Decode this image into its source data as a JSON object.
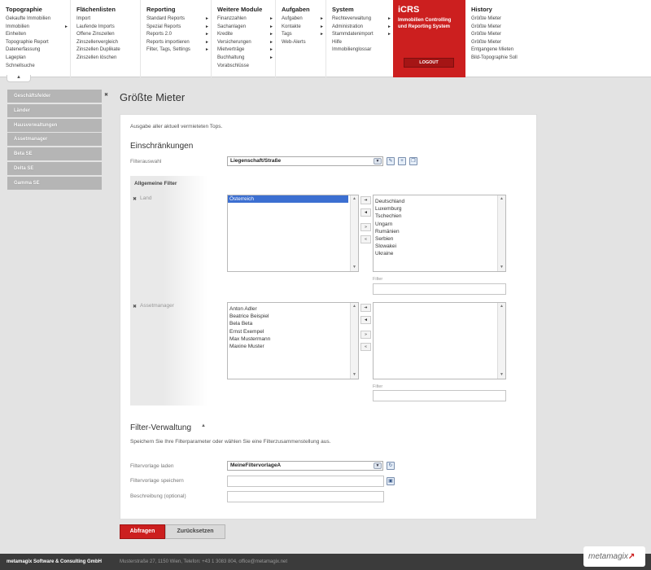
{
  "menu": {
    "topographie": {
      "head": "Topographie",
      "items": [
        "Gekaufte Immobilien",
        "Immobilien",
        "Einheiten",
        "Topographie Report",
        "Datenerfassung",
        "Lageplan",
        "Schnellsuche"
      ]
    },
    "flaechenlisten": {
      "head": "Flächenlisten",
      "items": [
        "Import",
        "Laufende Imports",
        "Offene Zinszellen",
        "Zinszellenvergleich",
        "Zinszellen Duplikate",
        "Zinszellen löschen"
      ]
    },
    "reporting": {
      "head": "Reporting",
      "items": [
        "Standard Reports",
        "Spezial Reports",
        "Reports 2.0",
        "Reports importieren",
        "Filter, Tags, Settings"
      ]
    },
    "weitere": {
      "head": "Weitere Module",
      "items": [
        "Finanzzahlen",
        "Sachanlagen",
        "Kredite",
        "Versicherungen",
        "Mietverträge",
        "Buchhaltung",
        "Vorabschlüsse"
      ]
    },
    "aufgaben": {
      "head": "Aufgaben",
      "items": [
        "Aufgaben",
        "Kontakte",
        "Tags",
        "Web-Alerts"
      ]
    },
    "system": {
      "head": "System",
      "items": [
        "Rechteverwaltung",
        "Administration",
        "Stammdatenimport",
        "Hilfe",
        "Immobilienglossar"
      ]
    },
    "history": {
      "head": "History",
      "items": [
        "Größte Mieter",
        "Größte Mieter",
        "Größte Mieter",
        "Größte Mieter",
        "Entgangene Mieten",
        "Bild-Topographie Soll"
      ]
    }
  },
  "brand": {
    "name": "iCRS",
    "subtitle_line1": "Immobilien Controlling",
    "subtitle_line2": "und Reporting System",
    "logout": "LOGOUT"
  },
  "sidebar": {
    "items": [
      "Geschäftsfelder",
      "Länder",
      "Hausverwaltungen",
      "Assetmanager",
      "Beta SE",
      "Delta SE",
      "Gamma SE"
    ],
    "close": "✖"
  },
  "page": {
    "title": "Größte Mieter",
    "intro": "Ausgabe aller aktuell vermieteten Tops.",
    "einschraenkungen": "Einschränkungen",
    "filterauswahl_label": "Filterauswahl",
    "filterauswahl_value": "Liegenschaft/Straße",
    "allgemeine_filter": "Allgemeine Filter",
    "land": {
      "label": "Land",
      "selected": [
        "Österreich"
      ],
      "available": [
        "Deutschland",
        "Luxemburg",
        "Tschechien",
        "Ungarn",
        "Rumänien",
        "Serbien",
        "Slowakei",
        "Ukraine"
      ],
      "filter_label": "Filter"
    },
    "assetmanager": {
      "label": "Assetmanager",
      "selected": [
        "Anton Adler",
        "Beatrice Beispiel",
        "Bela Beta",
        "Ernst Exempel",
        "Max Mustermann",
        "Maxine Muster"
      ],
      "available": [],
      "filter_label": "Filter"
    },
    "filterverwaltung": "Filter-Verwaltung",
    "filterverwaltung_text": "Speichern Sie Ihre Filterparameter oder wählen Sie eine Filterzusammenstellung aus.",
    "vorlage_laden_label": "Filtervorlage laden",
    "vorlage_laden_value": "MeineFiltervorlageA",
    "vorlage_speichern_label": "Filtervorlage speichern",
    "beschreibung_label": "Beschreibung (optional)"
  },
  "buttons": {
    "abfragen": "Abfragen",
    "reset": "Zurücksetzen"
  },
  "footer": {
    "company": "metamagix Software & Consulting GmbH",
    "address": "Musterstraße 27, 1150 Wien, Telefon: +43 1 3083 804, office@metamagix.net",
    "logo": "metamagix"
  },
  "colors": {
    "accent": "#cc1f1f",
    "sidebar": "#b5b5b5",
    "selection": "#3c6fd1"
  }
}
